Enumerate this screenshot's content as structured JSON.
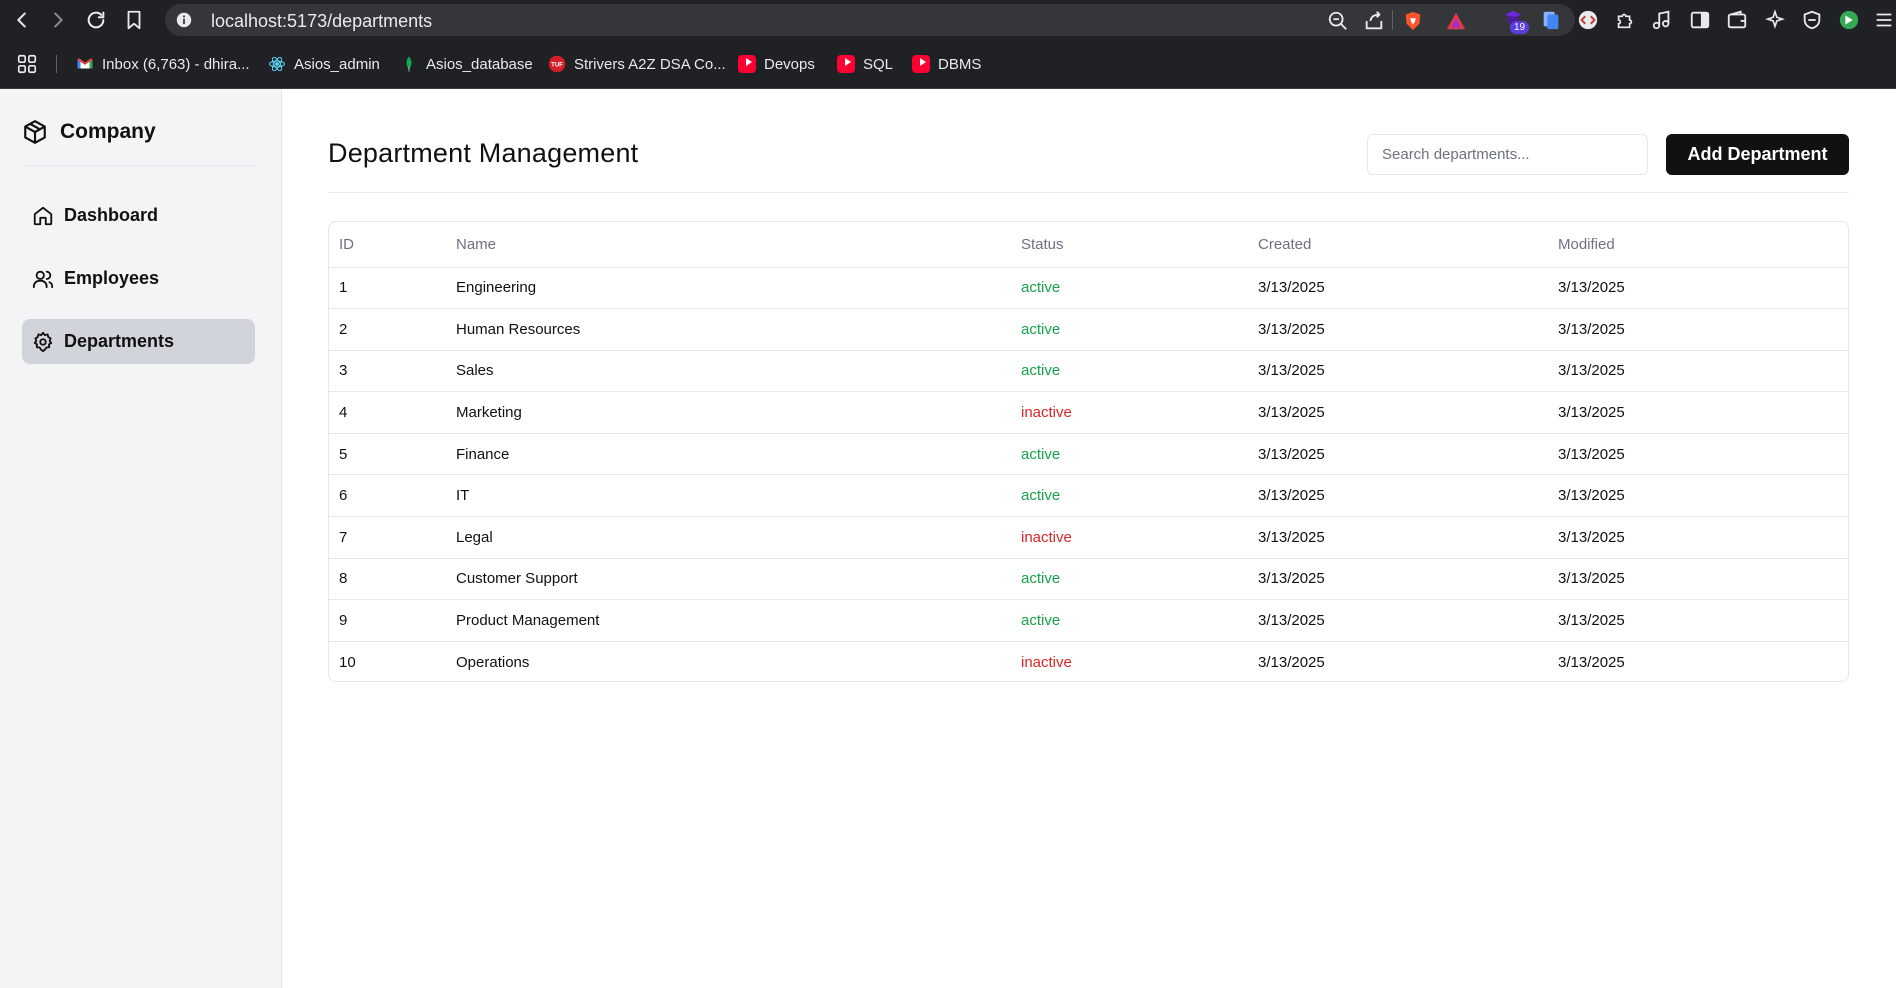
{
  "browser": {
    "url": "localhost:5173/departments",
    "extension_badge": "19",
    "bookmarks": [
      {
        "label": "Inbox (6,763) - dhira...",
        "icon": "gmail-icon"
      },
      {
        "label": "Asios_admin",
        "icon": "react-icon"
      },
      {
        "label": "Asios_database",
        "icon": "mongodb-leaf-icon"
      },
      {
        "label": "Strivers A2Z DSA Co...",
        "icon": "tuf-icon"
      },
      {
        "label": "Devops",
        "icon": "youtube-icon"
      },
      {
        "label": "SQL",
        "icon": "youtube-icon"
      },
      {
        "label": "DBMS",
        "icon": "youtube-icon"
      }
    ]
  },
  "sidebar": {
    "brand": "Company",
    "items": [
      {
        "label": "Dashboard",
        "icon": "home-icon",
        "active": false
      },
      {
        "label": "Employees",
        "icon": "users-icon",
        "active": false
      },
      {
        "label": "Departments",
        "icon": "gear-icon",
        "active": true
      }
    ]
  },
  "header": {
    "title": "Department Management",
    "search_placeholder": "Search departments...",
    "add_button": "Add Department"
  },
  "table": {
    "columns": [
      "ID",
      "Name",
      "Status",
      "Created",
      "Modified"
    ],
    "rows": [
      {
        "id": "1",
        "name": "Engineering",
        "status": "active",
        "created": "3/13/2025",
        "modified": "3/13/2025"
      },
      {
        "id": "2",
        "name": "Human Resources",
        "status": "active",
        "created": "3/13/2025",
        "modified": "3/13/2025"
      },
      {
        "id": "3",
        "name": "Sales",
        "status": "active",
        "created": "3/13/2025",
        "modified": "3/13/2025"
      },
      {
        "id": "4",
        "name": "Marketing",
        "status": "inactive",
        "created": "3/13/2025",
        "modified": "3/13/2025"
      },
      {
        "id": "5",
        "name": "Finance",
        "status": "active",
        "created": "3/13/2025",
        "modified": "3/13/2025"
      },
      {
        "id": "6",
        "name": "IT",
        "status": "active",
        "created": "3/13/2025",
        "modified": "3/13/2025"
      },
      {
        "id": "7",
        "name": "Legal",
        "status": "inactive",
        "created": "3/13/2025",
        "modified": "3/13/2025"
      },
      {
        "id": "8",
        "name": "Customer Support",
        "status": "active",
        "created": "3/13/2025",
        "modified": "3/13/2025"
      },
      {
        "id": "9",
        "name": "Product Management",
        "status": "active",
        "created": "3/13/2025",
        "modified": "3/13/2025"
      },
      {
        "id": "10",
        "name": "Operations",
        "status": "inactive",
        "created": "3/13/2025",
        "modified": "3/13/2025"
      }
    ]
  },
  "colors": {
    "active": "#16a34a",
    "inactive": "#dc2626",
    "primary_button": "#111111",
    "sidebar_bg": "#f3f4f6",
    "sidebar_active": "#d1d5db"
  }
}
